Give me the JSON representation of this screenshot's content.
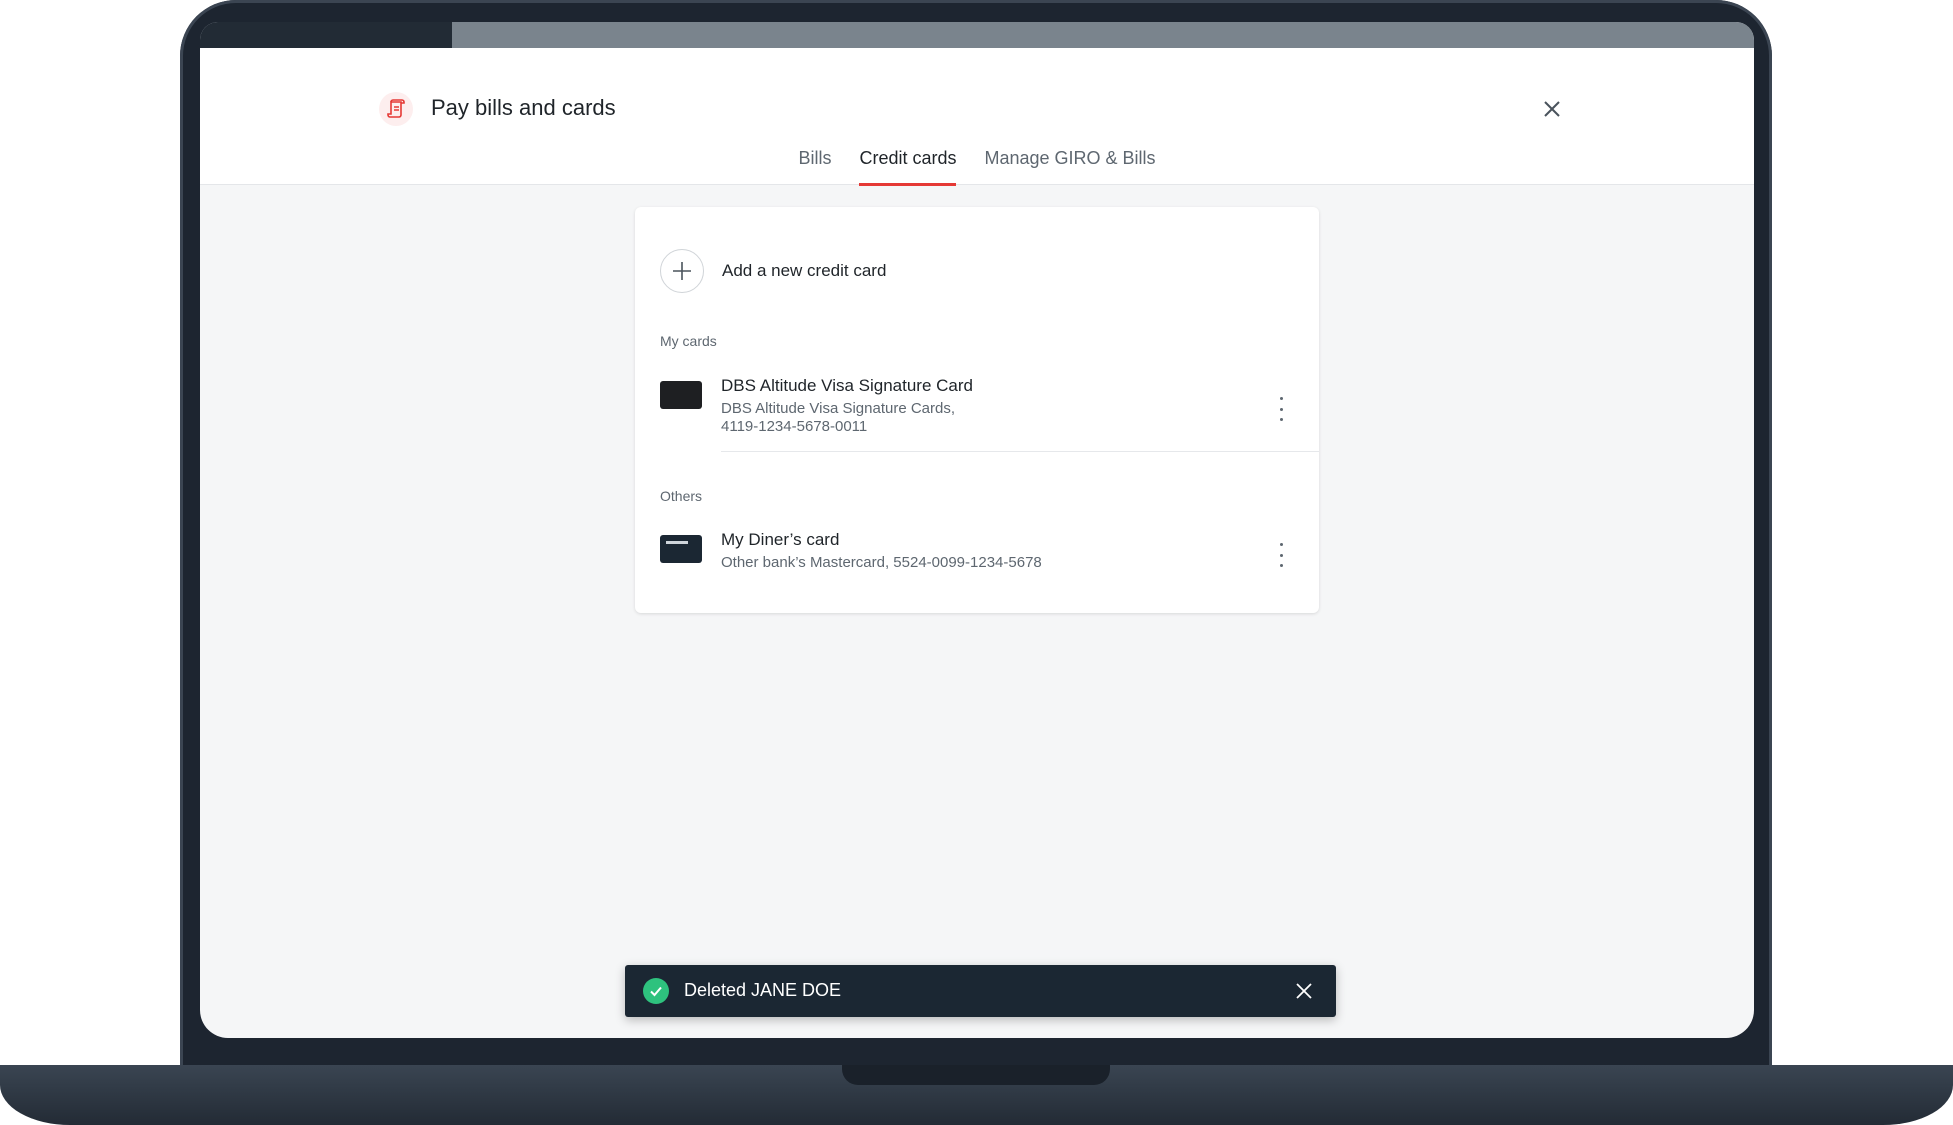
{
  "app": {
    "title": "Pay bills and cards",
    "accent_color": "#e53935",
    "icon": "bill-receipt-icon"
  },
  "tabs": [
    {
      "label": "Bills",
      "active": false
    },
    {
      "label": "Credit cards",
      "active": true
    },
    {
      "label": "Manage GIRO & Bills",
      "active": false
    }
  ],
  "panel": {
    "add_label": "Add a new credit card",
    "my_cards_label": "My cards",
    "others_label": "Others",
    "my_cards": [
      {
        "name": "DBS Altitude Visa Signature Card",
        "sub1": "DBS Altitude Visa Signature Cards,",
        "sub2": "4119-1234-5678-0011"
      }
    ],
    "others": [
      {
        "name": "My Diner’s card",
        "sub1": "Other bank’s Mastercard, 5524-0099-1234-5678"
      }
    ]
  },
  "toast": {
    "message": "Deleted JANE DOE",
    "status_color": "#2ec27e"
  }
}
